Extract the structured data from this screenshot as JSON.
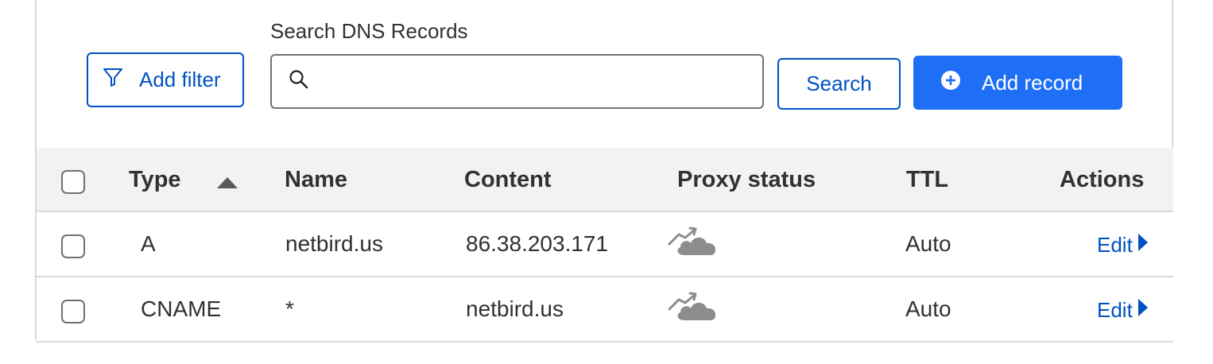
{
  "toolbar": {
    "add_filter_label": "Add filter",
    "search_label": "Search DNS Records",
    "search_value": "",
    "search_button_label": "Search",
    "add_record_label": "Add record"
  },
  "table": {
    "columns": [
      "Type",
      "Name",
      "Content",
      "Proxy status",
      "TTL",
      "Actions"
    ],
    "sort_icon": "sort-ascending-icon",
    "rows": [
      {
        "type": "A",
        "name": "netbird.us",
        "content": "86.38.203.171",
        "proxy_icon": "dns-only-cloud-icon",
        "ttl": "Auto",
        "action": "Edit"
      },
      {
        "type": "CNAME",
        "name": "*",
        "content": "netbird.us",
        "proxy_icon": "dns-only-cloud-icon",
        "ttl": "Auto",
        "action": "Edit"
      }
    ]
  },
  "colors": {
    "accent": "#0051c3",
    "primary_button": "#1f6ff6",
    "header_bg": "#f2f2f2",
    "cloud_gray": "#8c8c8c"
  }
}
